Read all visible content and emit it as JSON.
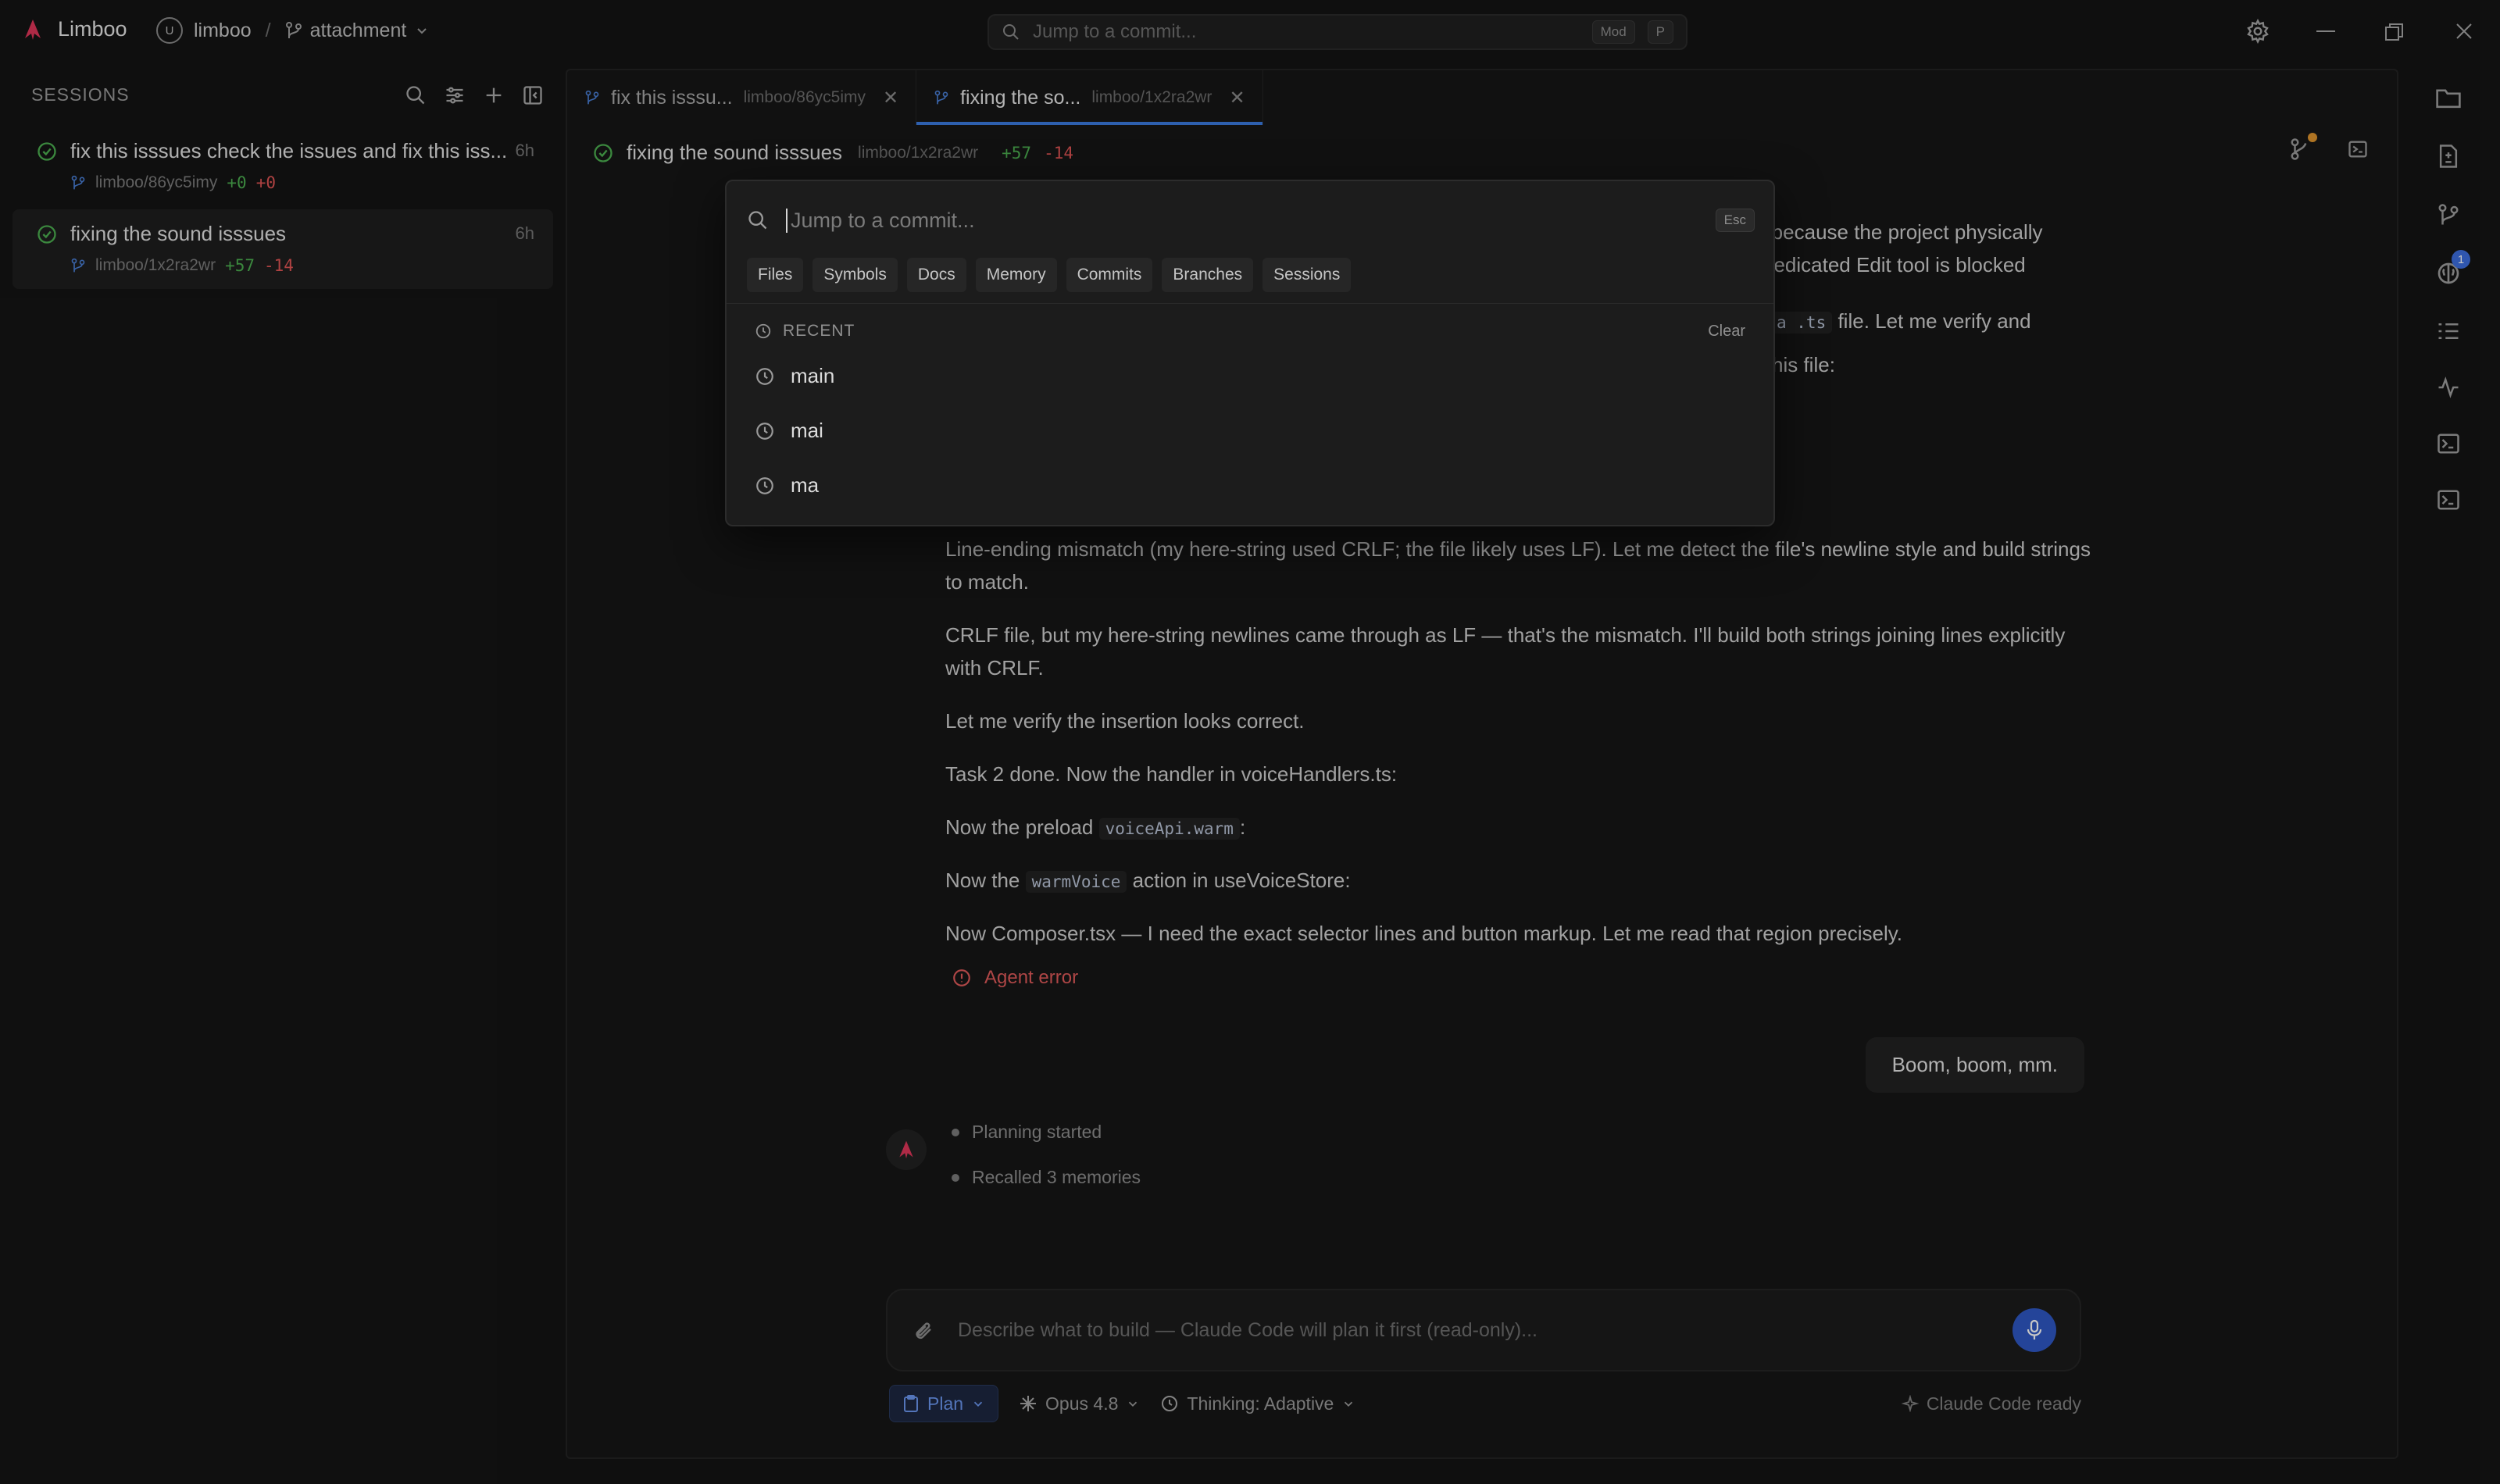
{
  "app": {
    "name": "Limboo",
    "repo_initial": "U",
    "repo": "limboo",
    "separator": "/",
    "branch": "attachment",
    "command_placeholder": "Jump to a commit...",
    "shortcut_mod": "Mod",
    "shortcut_key": "P",
    "accent": "#3b7be0",
    "brand_color": "#e0365a"
  },
  "sidebar": {
    "heading": "SESSIONS",
    "sessions": [
      {
        "title": "fix this isssues check the issues and fix this iss...",
        "age": "6h",
        "branch": "limboo/86yc5imy",
        "added": "+0",
        "removed": "+0"
      },
      {
        "title": "fixing the sound isssues",
        "age": "6h",
        "branch": "limboo/1x2ra2wr",
        "added": "+57",
        "removed": "-14"
      }
    ]
  },
  "tabs": [
    {
      "label": "fix this isssu...",
      "branch": "limboo/86yc5imy"
    },
    {
      "label": "fixing the so...",
      "branch": "limboo/1x2ra2wr"
    }
  ],
  "session_header": {
    "title": "fixing the sound isssues",
    "branch": "limboo/1x2ra2wr",
    "added": "+57",
    "removed": "-14"
  },
  "messages": {
    "partial_1": "e because the project physically",
    "partial_2": "dedicated Edit tool is blocked",
    "partial_3_code": "a .ts",
    "partial_3_text": "file. Let me verify and",
    "partial_4": "his file:",
    "m1": "Line-ending mismatch (my here-string used CRLF; the file likely uses LF). Let me detect the file's newline style and build strings to match.",
    "m2": "CRLF file, but my here-string newlines came through as LF — that's the mismatch. I'll build both strings joining lines explicitly with CRLF.",
    "m3": "Let me verify the insertion looks correct.",
    "m4": "Task 2 done. Now the handler in voiceHandlers.ts:",
    "m5_prefix": "Now the preload",
    "m5_code": "voiceApi.warm",
    "m5_suffix": ":",
    "m6_prefix": "Now the",
    "m6_code": "warmVoice",
    "m6_suffix": "action in useVoiceStore:",
    "m7": "Now Composer.tsx — I need the exact selector lines and button markup. Let me read that region precisely.",
    "error": "Agent error",
    "user_bubble": "Boom, boom, mm.",
    "step_1": "Planning started",
    "step_2": "Recalled 3 memories"
  },
  "composer": {
    "placeholder": "Describe what to build — Claude Code will plan it first (read-only)...",
    "plan_label": "Plan",
    "model_label": "Opus 4.8",
    "thinking_label": "Thinking: Adaptive",
    "status": "Claude Code ready"
  },
  "rail": {
    "badge_count": "1"
  },
  "palette": {
    "placeholder": "Jump to a commit...",
    "esc_label": "Esc",
    "filters": [
      "Files",
      "Symbols",
      "Docs",
      "Memory",
      "Commits",
      "Branches",
      "Sessions"
    ],
    "recent_heading": "RECENT",
    "clear_label": "Clear",
    "recent": [
      "main",
      "mai",
      "ma"
    ]
  }
}
